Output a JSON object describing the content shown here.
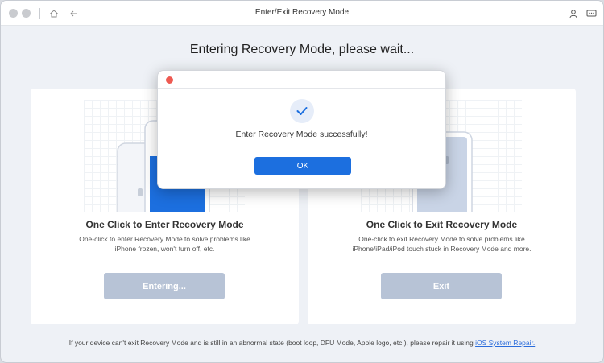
{
  "window": {
    "title": "Enter/Exit Recovery Mode"
  },
  "titlebar": {
    "icons": [
      "home-icon",
      "back-arrow-icon",
      "user-icon",
      "feedback-icon"
    ]
  },
  "heading": "Entering Recovery Mode, please wait...",
  "cards": {
    "enter": {
      "title": "One Click to Enter Recovery Mode",
      "desc_line1": "One-click to enter Recovery Mode to solve problems like",
      "desc_line2": "iPhone frozen, won't turn off, etc.",
      "button": "Entering..."
    },
    "exit": {
      "title": "One Click to Exit Recovery Mode",
      "desc_line1": "One-click to exit Recovery Mode to solve problems like",
      "desc_line2": "iPhone/iPad/iPod touch stuck in Recovery Mode and more.",
      "button": "Exit"
    }
  },
  "footer": {
    "text": "If your device can't exit Recovery Mode and is still in an abnormal state (boot loop, DFU Mode, Apple logo, etc.), please repair it using",
    "link": "iOS System Repair."
  },
  "modal": {
    "message": "Enter Recovery Mode successfully!",
    "ok": "OK"
  },
  "colors": {
    "accent": "#1c6fdf",
    "disabled": "#b7c3d6",
    "close": "#ee5a52"
  }
}
